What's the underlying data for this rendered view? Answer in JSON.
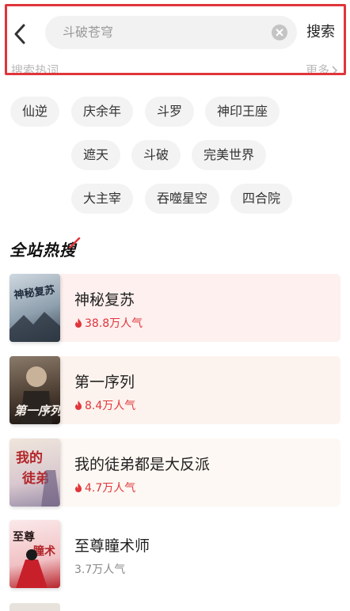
{
  "search": {
    "back_icon": "chevron-left-icon",
    "query": "斗破苍穹",
    "clear_icon": "clear-circle-icon",
    "submit_label": "搜索",
    "hot_label": "搜索热词",
    "more_label": "更多"
  },
  "hot_words": [
    "仙逆",
    "庆余年",
    "斗罗",
    "神印王座",
    "遮天",
    "斗破",
    "完美世界",
    "大主宰",
    "吞噬星空",
    "四合院"
  ],
  "ranking": {
    "title": "全站热搜",
    "items": [
      {
        "title": "神秘复苏",
        "heat": "38.8万人气",
        "hot": true,
        "cover_text": "神秘复苏"
      },
      {
        "title": "第一序列",
        "heat": "8.4万人气",
        "hot": true,
        "cover_text": "第一序列"
      },
      {
        "title": "我的徒弟都是大反派",
        "heat": "4.7万人气",
        "hot": true,
        "cover_text": "我的徒弟"
      },
      {
        "title": "至尊瞳术师",
        "heat": "3.7万人气",
        "hot": false,
        "cover_text": "至尊瞳术师"
      }
    ]
  },
  "colors": {
    "accent": "#e0353b",
    "card_pink": "#fdf0ef",
    "card_peach": "#fdf3ee",
    "card_cream": "#fdf8f3"
  }
}
